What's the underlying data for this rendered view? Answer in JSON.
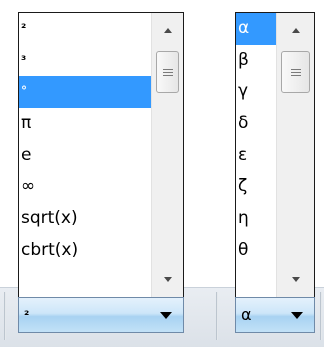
{
  "left_dropdown": {
    "selected_value": "²",
    "items": [
      {
        "label": "²",
        "small": true,
        "selected": false
      },
      {
        "label": "³",
        "small": true,
        "selected": false
      },
      {
        "label": "°",
        "small": true,
        "selected": true
      },
      {
        "label": "π",
        "small": false,
        "selected": false
      },
      {
        "label": "e",
        "small": false,
        "selected": false
      },
      {
        "label": "∞",
        "small": false,
        "selected": false
      },
      {
        "label": "sqrt(x)",
        "small": false,
        "selected": false
      },
      {
        "label": "cbrt(x)",
        "small": false,
        "selected": false
      }
    ],
    "scroll_position": 0.0
  },
  "right_dropdown": {
    "selected_value": "α",
    "items": [
      {
        "label": "α",
        "small": false,
        "selected": true
      },
      {
        "label": "β",
        "small": false,
        "selected": false
      },
      {
        "label": "γ",
        "small": false,
        "selected": false
      },
      {
        "label": "δ",
        "small": false,
        "selected": false
      },
      {
        "label": "ε",
        "small": false,
        "selected": false
      },
      {
        "label": "ζ",
        "small": false,
        "selected": false
      },
      {
        "label": "η",
        "small": false,
        "selected": false
      },
      {
        "label": "θ",
        "small": false,
        "selected": false
      }
    ],
    "scroll_position": 0.0
  },
  "colors": {
    "selection": "#3399ff",
    "combo_gradient_mid": "#a8d2f2",
    "popup_border": "#1a1a1a"
  },
  "icons": {
    "scroll_up": "chevron-up-icon",
    "scroll_down": "chevron-down-icon",
    "combo_toggle": "caret-down-icon",
    "thumb_grip": "grip-lines-icon"
  }
}
